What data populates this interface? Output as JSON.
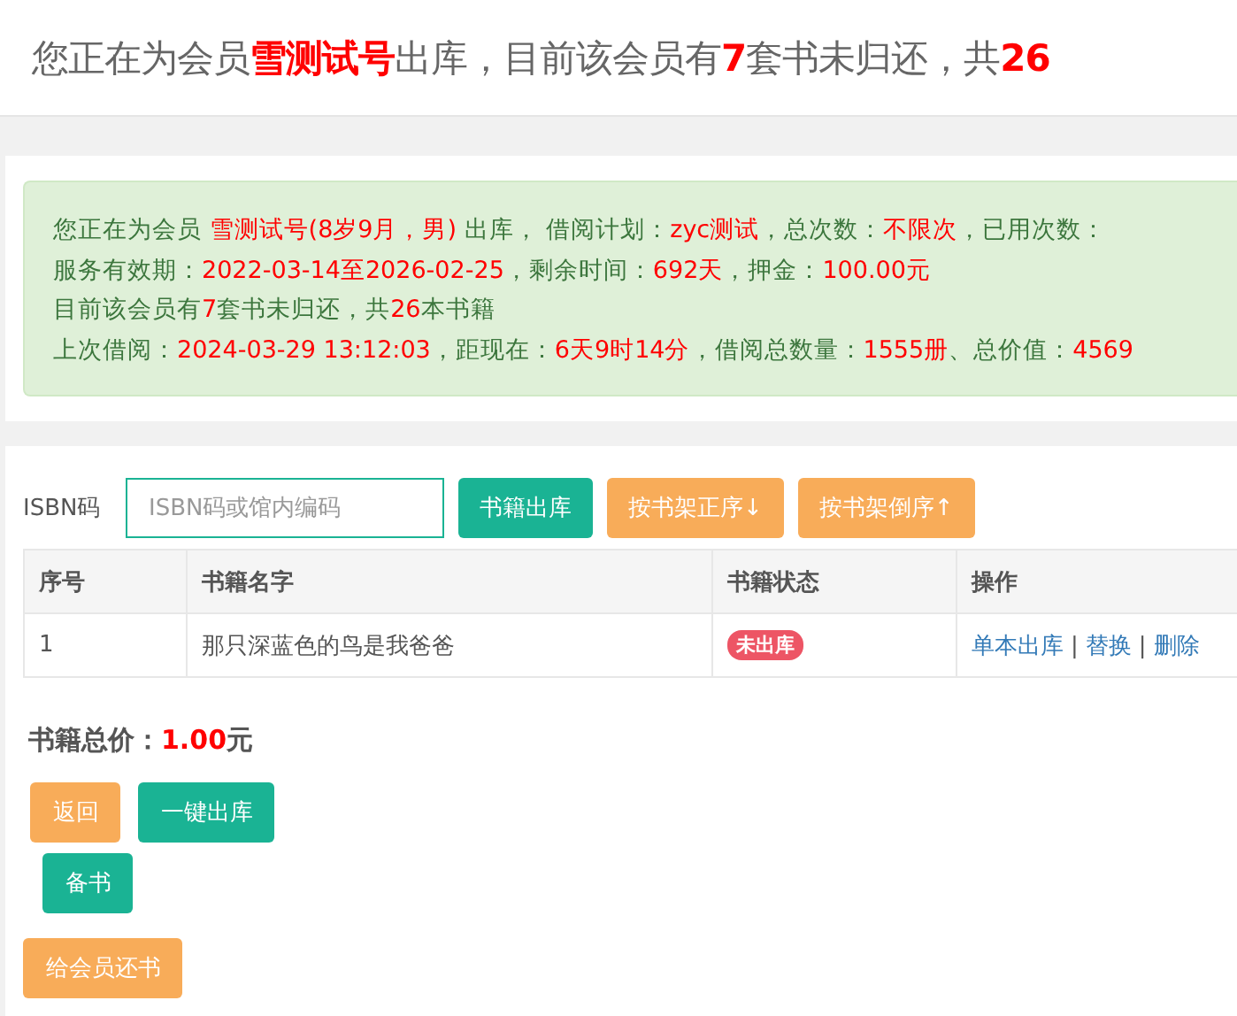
{
  "headline": [
    {
      "text": "您正在为会员",
      "emphasis": false
    },
    {
      "text": "雪测试号",
      "emphasis": true
    },
    {
      "text": "出库，目前该会员有",
      "emphasis": false
    },
    {
      "text": "7",
      "emphasis": true
    },
    {
      "text": "套书未归还，共",
      "emphasis": false
    },
    {
      "text": "26",
      "emphasis": true
    }
  ],
  "info_lines": [
    [
      {
        "text": "您正在为会员 ",
        "highlight": false
      },
      {
        "text": "雪测试号(8岁9月，男)",
        "highlight": true
      },
      {
        "text": " 出库， 借阅计划：",
        "highlight": false
      },
      {
        "text": "zyc测试",
        "highlight": true
      },
      {
        "text": "，总次数：",
        "highlight": false
      },
      {
        "text": "不限次",
        "highlight": true
      },
      {
        "text": "，已用次数：",
        "highlight": false
      }
    ],
    [
      {
        "text": "服务有效期：",
        "highlight": false
      },
      {
        "text": "2022-03-14至2026-02-25",
        "highlight": true
      },
      {
        "text": "，剩余时间：",
        "highlight": false
      },
      {
        "text": "692天",
        "highlight": true
      },
      {
        "text": "，押金：",
        "highlight": false
      },
      {
        "text": "100.00元",
        "highlight": true
      }
    ],
    [
      {
        "text": "目前该会员有",
        "highlight": false
      },
      {
        "text": "7",
        "highlight": true
      },
      {
        "text": "套书未归还，共",
        "highlight": false
      },
      {
        "text": "26",
        "highlight": true
      },
      {
        "text": "本书籍",
        "highlight": false
      }
    ],
    [
      {
        "text": "上次借阅：",
        "highlight": false
      },
      {
        "text": "2024-03-29 13:12:03",
        "highlight": true
      },
      {
        "text": "，距现在：",
        "highlight": false
      },
      {
        "text": "6天9时14分",
        "highlight": true
      },
      {
        "text": "，借阅总数量：",
        "highlight": false
      },
      {
        "text": "1555册",
        "highlight": true
      },
      {
        "text": "、总价值：",
        "highlight": false
      },
      {
        "text": "4569",
        "highlight": true
      }
    ]
  ],
  "isbn": {
    "label": "ISBN码",
    "placeholder": "ISBN码或馆内编码"
  },
  "toolbar_buttons": [
    {
      "label": "书籍出库",
      "kind": "primary"
    },
    {
      "label": "按书架正序↓",
      "kind": "warning"
    },
    {
      "label": "按书架倒序↑",
      "kind": "warning"
    }
  ],
  "table": {
    "columns": [
      "序号",
      "书籍名字",
      "书籍状态",
      "操作"
    ],
    "rows": [
      {
        "index": "1",
        "title": "那只深蓝色的鸟是我爸爸",
        "status": "未出库",
        "actions": [
          "单本出库",
          "替换",
          "删除"
        ],
        "separator": "|"
      }
    ]
  },
  "total": {
    "label": "书籍总价：",
    "amount": "1.00",
    "unit": "元"
  },
  "action_rows": [
    [
      {
        "label": "返回",
        "kind": "warning"
      },
      {
        "label": "一键出库",
        "kind": "primary"
      }
    ],
    [
      {
        "label": "备书",
        "kind": "primary"
      }
    ],
    [
      {
        "label": "给会员还书",
        "kind": "warning"
      }
    ]
  ]
}
